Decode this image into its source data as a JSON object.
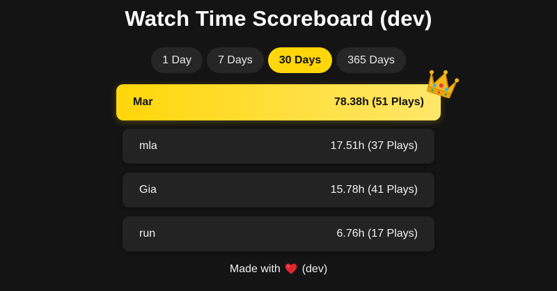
{
  "title": "Watch Time Scoreboard (dev)",
  "tabs": [
    {
      "label": "1 Day"
    },
    {
      "label": "7 Days"
    },
    {
      "label": "30 Days"
    },
    {
      "label": "365 Days"
    }
  ],
  "active_tab_index": 2,
  "leaderboard": [
    {
      "name": "Mar",
      "stat": "78.38h (51 Plays)"
    },
    {
      "name": "mla",
      "stat": "17.51h (37 Plays)"
    },
    {
      "name": "Gia",
      "stat": "15.78h (41 Plays)"
    },
    {
      "name": "run",
      "stat": "6.76h (17 Plays)"
    }
  ],
  "footer": {
    "prefix": "Made with",
    "icon": "heart-icon",
    "suffix": "(dev)"
  },
  "colors": {
    "background": "#141414",
    "accent": "#ffd60a",
    "row_background": "#232323",
    "tab_background": "#262626",
    "heart": "#e0262f"
  },
  "icons": {
    "winner": "crown-icon"
  }
}
